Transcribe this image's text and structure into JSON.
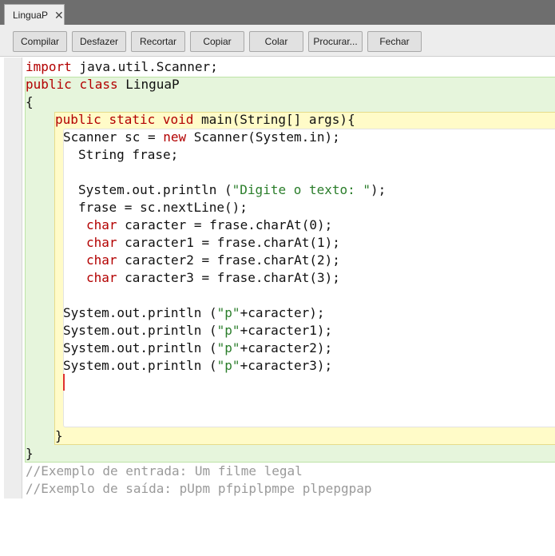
{
  "tab": {
    "label": "LinguaP",
    "close": "✕"
  },
  "toolbar": {
    "compile": "Compilar",
    "undo": "Desfazer",
    "cut": "Recortar",
    "copy": "Copiar",
    "paste": "Colar",
    "find": "Procurar...",
    "close": "Fechar"
  },
  "code": {
    "l1_kw": "import",
    "l1_rest": " java.util.Scanner;",
    "l2_kw1": "public",
    "l2_kw2": "class",
    "l2_rest": " LinguaP",
    "l3": "{",
    "l4_kw1": "public",
    "l4_kw2": "static",
    "l4_kw3": "void",
    "l4_rest": " main(String[] args){",
    "l5_a": "Scanner sc = ",
    "l5_kw": "new",
    "l5_b": " Scanner(System.in);",
    "l6": "String frase;",
    "l7_a": "System.out.println (",
    "l7_str": "\"Digite o texto: \"",
    "l7_b": ");",
    "l8": "frase = sc.nextLine();",
    "char_kw": "char",
    "l9": " caracter = frase.charAt(0);",
    "l10": " caracter1 = frase.charAt(1);",
    "l11": " caracter2 = frase.charAt(2);",
    "l12": " caracter3 = frase.charAt(3);",
    "print_a": "System.out.println (",
    "print_str": "\"p\"",
    "l13_b": "+caracter);",
    "l14_b": "+caracter1);",
    "l15_b": "+caracter2);",
    "l16_b": "+caracter3);",
    "close_method": "}",
    "close_class": "}",
    "comment1": "//Exemplo de entrada: Um filme legal",
    "comment2": "//Exemplo de saída: pUpm pfpiplpmpe plpepgpap"
  },
  "colors": {
    "keyword": "#b30000",
    "string": "#2a7d2a",
    "comment": "#9a9a9a",
    "class_scope": "#e6f5dc",
    "method_scope": "#fffbc8",
    "caret": "#e0302f"
  }
}
